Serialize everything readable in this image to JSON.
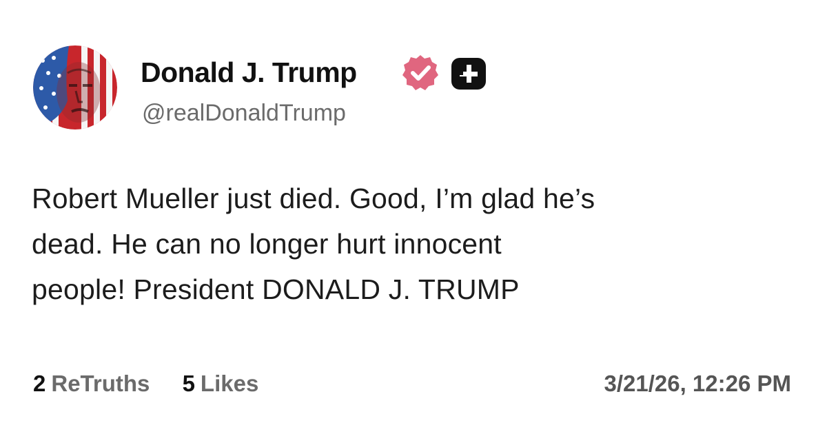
{
  "post": {
    "author": {
      "display_name": "Donald J. Trump",
      "handle": "@realDonaldTrump",
      "verified": true,
      "verified_badge_color": "#e0667f",
      "avatar_icon": "flag-portrait-avatar"
    },
    "body_lines": [
      "Robert Mueller just died. Good, I’m glad he’s",
      "dead. He can no longer hurt innocent",
      "people! President DONALD J. TRUMP"
    ],
    "stats": {
      "retruths_count": "2",
      "retruths_label": "ReTruths",
      "likes_count": "5",
      "likes_label": "Likes"
    },
    "timestamp": "3/21/26, 12:26 PM"
  }
}
